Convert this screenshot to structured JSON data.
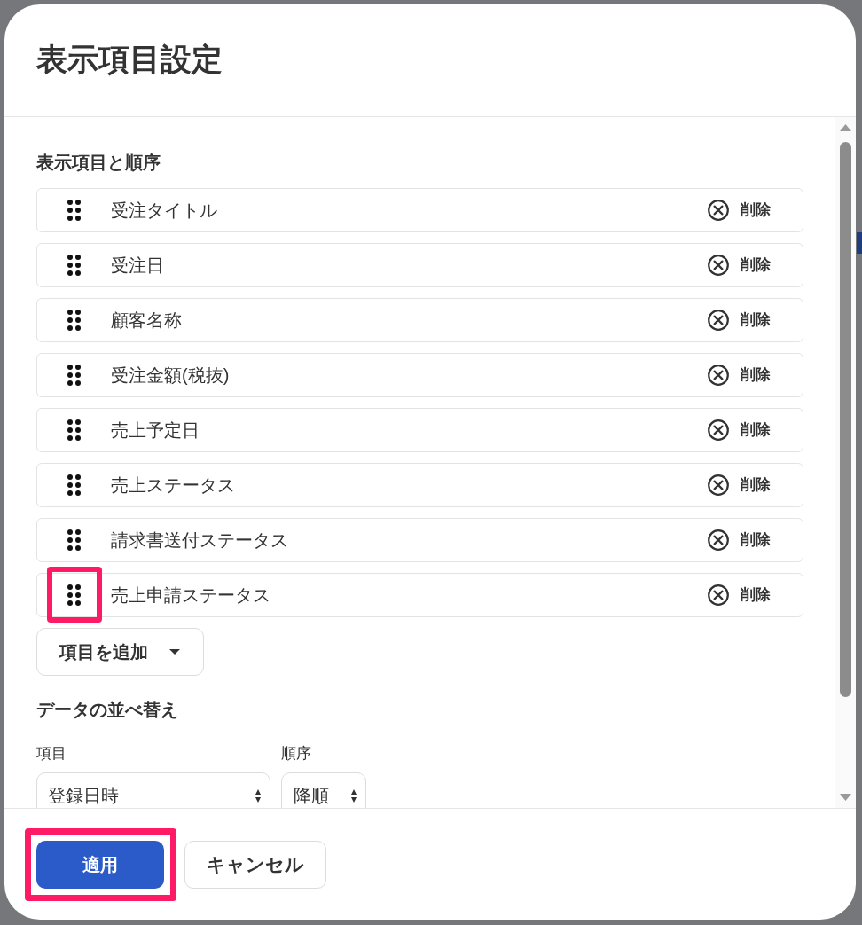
{
  "window": {
    "title": "表示項目設定"
  },
  "display_items": {
    "heading": "表示項目と順序",
    "items": [
      {
        "label": "受注タイトル",
        "delete_label": "削除",
        "highlighted": false
      },
      {
        "label": "受注日",
        "delete_label": "削除",
        "highlighted": false
      },
      {
        "label": "顧客名称",
        "delete_label": "削除",
        "highlighted": false
      },
      {
        "label": "受注金額(税抜)",
        "delete_label": "削除",
        "highlighted": false
      },
      {
        "label": "売上予定日",
        "delete_label": "削除",
        "highlighted": false
      },
      {
        "label": "売上ステータス",
        "delete_label": "削除",
        "highlighted": false
      },
      {
        "label": "請求書送付ステータス",
        "delete_label": "削除",
        "highlighted": false
      },
      {
        "label": "売上申請ステータス",
        "delete_label": "削除",
        "highlighted": true
      }
    ],
    "add_button": {
      "label": "項目を追加"
    }
  },
  "sort": {
    "heading": "データの並べ替え",
    "field": {
      "label": "項目",
      "value": "登録日時"
    },
    "order": {
      "label": "順序",
      "value": "降順"
    }
  },
  "buttons": [
    {
      "label": "適用",
      "kind": "primary",
      "highlighted": true
    },
    {
      "label": "キャンセル",
      "kind": "secondary",
      "highlighted": false
    }
  ]
}
